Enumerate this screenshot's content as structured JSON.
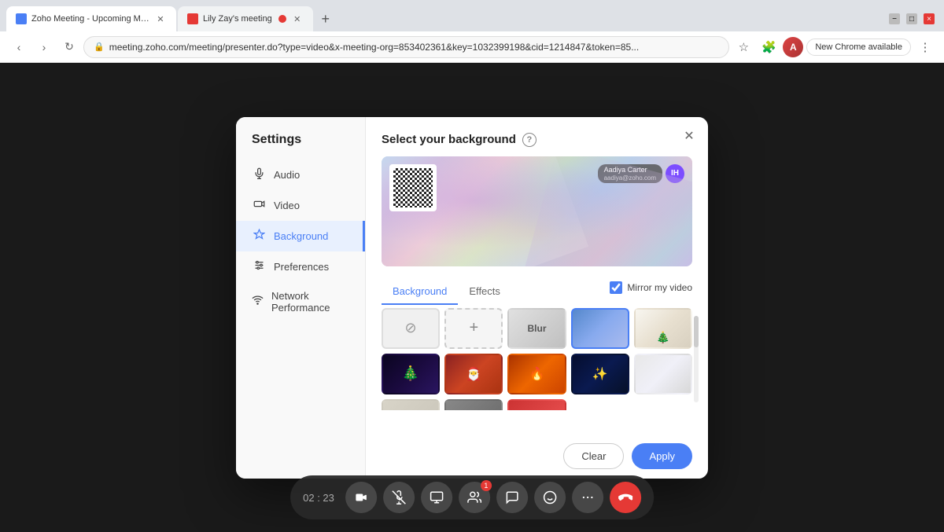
{
  "browser": {
    "tabs": [
      {
        "id": "tab1",
        "favicon_color": "#4a7ff5",
        "title": "Zoho Meeting - Upcoming Me...",
        "active": true
      },
      {
        "id": "tab2",
        "favicon_color": "#e53935",
        "title": "Lily Zay's meeting",
        "active": false
      }
    ],
    "add_tab_label": "+",
    "address": "meeting.zoho.com/meeting/presenter.do?type=video&x-meeting-org=853402361&key=1032399198&cid=1214847&token=85...",
    "chrome_available": "New Chrome available",
    "window_controls": {
      "minimize": "−",
      "maximize": "□",
      "close": "×"
    }
  },
  "settings": {
    "title": "Settings",
    "close_label": "×",
    "sidebar_items": [
      {
        "id": "audio",
        "label": "Audio",
        "icon": "🎤"
      },
      {
        "id": "video",
        "label": "Video",
        "icon": "📹"
      },
      {
        "id": "background",
        "label": "Background",
        "icon": "✦",
        "active": true
      },
      {
        "id": "preferences",
        "label": "Preferences",
        "icon": "⚙"
      },
      {
        "id": "network",
        "label": "Network Performance",
        "icon": "📶"
      }
    ],
    "content": {
      "title": "Select your background",
      "help_icon": "?",
      "tabs": [
        {
          "id": "background",
          "label": "Background",
          "active": true
        },
        {
          "id": "effects",
          "label": "Effects",
          "active": false
        }
      ],
      "mirror_label": "Mirror my video",
      "mirror_checked": true,
      "participant_name": "Aadiya Carter",
      "avatar_initials": "IH",
      "backgrounds": [
        {
          "id": "none",
          "type": "none",
          "label": "None"
        },
        {
          "id": "add",
          "type": "add",
          "label": "Add"
        },
        {
          "id": "blur",
          "type": "blur",
          "label": "Blur"
        },
        {
          "id": "sky",
          "type": "image",
          "class": "thumb-blue",
          "selected": true
        },
        {
          "id": "room1",
          "type": "image",
          "class": "thumb-white-room"
        },
        {
          "id": "xmas1",
          "type": "image",
          "class": "thumb-xmas-dark"
        },
        {
          "id": "xmas2",
          "type": "image",
          "class": "thumb-xmas-warm"
        },
        {
          "id": "xmas3",
          "type": "image",
          "class": "thumb-xmas-fire"
        },
        {
          "id": "xmas4",
          "type": "image",
          "class": "thumb-xmas-night"
        },
        {
          "id": "room2",
          "type": "image",
          "class": "thumb-light-room"
        },
        {
          "id": "partial1",
          "type": "image",
          "class": "thumb-partial1"
        },
        {
          "id": "partial2",
          "type": "image",
          "class": "thumb-partial2"
        },
        {
          "id": "partial3",
          "type": "image",
          "class": "thumb-partial3"
        }
      ],
      "clear_label": "Clear",
      "apply_label": "Apply"
    }
  },
  "meeting": {
    "timer": "02 : 23",
    "toolbar_buttons": [
      {
        "id": "camera",
        "icon": "📷",
        "type": "normal"
      },
      {
        "id": "mic",
        "icon": "🎤",
        "type": "muted"
      },
      {
        "id": "screen",
        "icon": "🖥",
        "type": "normal"
      },
      {
        "id": "participants",
        "icon": "👥",
        "type": "badge",
        "badge": "1"
      },
      {
        "id": "chat",
        "icon": "💬",
        "type": "normal"
      },
      {
        "id": "reactions",
        "icon": "🙌",
        "type": "normal"
      },
      {
        "id": "more",
        "icon": "•••",
        "type": "normal"
      },
      {
        "id": "end",
        "icon": "📞",
        "type": "danger"
      }
    ]
  }
}
